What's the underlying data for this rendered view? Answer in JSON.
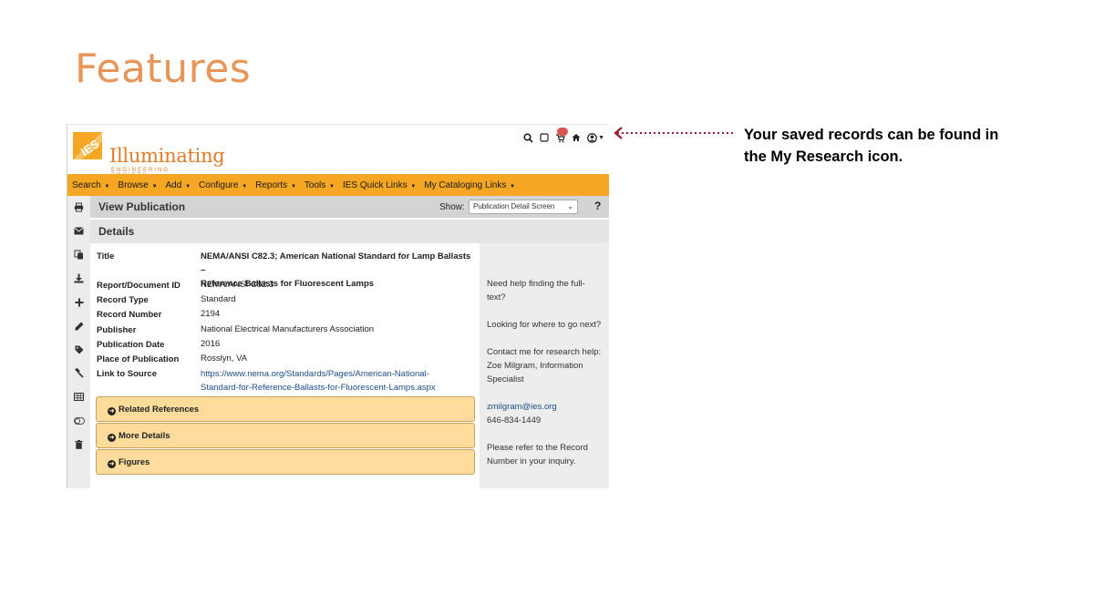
{
  "slide": {
    "title": "Features",
    "callout_text": "Your saved records can be found in the My Research icon."
  },
  "app": {
    "logo": {
      "badge_text": "IES",
      "name": "Illuminating",
      "sub": "ENGINEERING SOCIETY"
    },
    "top_icons": [
      "search-icon",
      "checkbox-icon",
      "my-research-cart-icon",
      "home-icon",
      "user-icon"
    ],
    "menu": [
      {
        "label": "Search"
      },
      {
        "label": "Browse"
      },
      {
        "label": "Add"
      },
      {
        "label": "Configure"
      },
      {
        "label": "Reports"
      },
      {
        "label": "Tools"
      },
      {
        "label": "IES Quick Links"
      },
      {
        "label": "My Cataloging Links"
      }
    ],
    "side_tools": [
      "print-icon",
      "email-icon",
      "copy-icon",
      "download-icon",
      "plus-icon",
      "pencil-icon",
      "tag-icon",
      "gavel-icon",
      "table-icon",
      "toggle-icon",
      "trash-icon"
    ],
    "pub_header": {
      "title": "View Publication",
      "show_label": "Show:",
      "show_value": "Publication Detail Screen",
      "help": "?"
    },
    "details_title": "Details",
    "fields": [
      {
        "label": "Title",
        "value_lines": [
          "NEMA/ANSI C82.3; American National Standard for Lamp Ballasts –",
          "Reference Ballasts for Fluorescent Lamps"
        ]
      },
      {
        "label": "Report/Document ID",
        "value": "NEMA/ANSI C82.3"
      },
      {
        "label": "Record Type",
        "value": "Standard"
      },
      {
        "label": "Record Number",
        "value": "2194"
      },
      {
        "label": "Publisher",
        "value": "National Electrical Manufacturers Association"
      },
      {
        "label": "Publication Date",
        "value": "2016"
      },
      {
        "label": "Place of Publication",
        "value": "Rosslyn, VA"
      },
      {
        "label": "Link to Source",
        "value_lines": [
          "https://www.nema.org/Standards/Pages/American-National-",
          "Standard-for-Reference-Ballasts-for-Fluorescent-Lamps.aspx"
        ]
      }
    ],
    "accordions": [
      {
        "label": "Related References"
      },
      {
        "label": "More Details"
      },
      {
        "label": "Figures"
      }
    ],
    "help_panel": {
      "full_text_1": "Need help finding the full-",
      "full_text_2": "text?",
      "next": "Looking for where to go next?",
      "contact_1": "Contact me for research help:",
      "contact_2": "Zoe Milgram, Information",
      "contact_3": "Specialist",
      "email": "zmilgram@ies.org",
      "phone": "646-834-1449",
      "refer_1": "Please refer to the Record",
      "refer_2": "Number in your inquiry."
    }
  }
}
